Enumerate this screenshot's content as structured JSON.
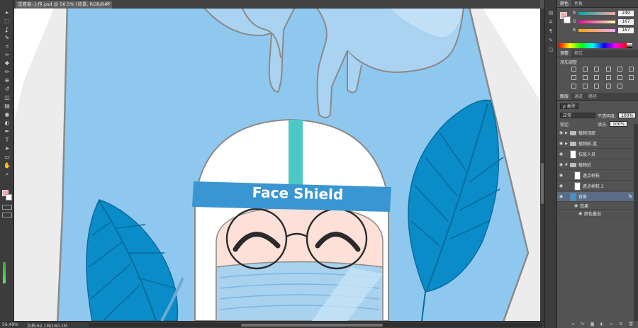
{
  "document": {
    "tab_title": "志愿者-上传.psd @ 56.5% (背景, RGB/8#)",
    "close_glyph": "×"
  },
  "canvas": {
    "banner_text": "Face Shield"
  },
  "status": {
    "zoom": "56.49%",
    "doc_size": "文档:62.1M/160.1M"
  },
  "colors": {
    "accent_blue": "#3a96d2",
    "teal_stripe": "#4cc8c4",
    "leaf_blue": "#0a8cc8",
    "face_pink": "#fde0d8",
    "mask_blue": "#a8d2ee",
    "foreground_swatch": "#f9a7a7"
  },
  "tools": [
    "move-tool",
    "marquee-tool",
    "lasso-tool",
    "quick-select-tool",
    "crop-tool",
    "eyedropper-tool",
    "spot-heal-tool",
    "brush-tool",
    "clone-stamp-tool",
    "history-brush-tool",
    "eraser-tool",
    "gradient-tool",
    "blur-tool",
    "dodge-tool",
    "pen-tool",
    "type-tool",
    "path-select-tool",
    "shape-tool",
    "hand-tool",
    "zoom-tool"
  ],
  "tool_glyphs": [
    "▸",
    "⬚",
    "ʆ",
    "✎",
    "⌗",
    "✑",
    "✚",
    "✏",
    "⊕",
    "↺",
    "◫",
    "▤",
    "◉",
    "◐",
    "✒",
    "T",
    "➤",
    "▭",
    "✋",
    "⌕"
  ],
  "color_panel": {
    "tabs": [
      "颜色",
      "色板"
    ],
    "channels": [
      {
        "ch": "R",
        "value": "249"
      },
      {
        "ch": "G",
        "value": "167"
      },
      {
        "ch": "B",
        "value": "167"
      }
    ]
  },
  "adjust_panel": {
    "tabs": [
      "调整",
      "样式"
    ],
    "title": "添加调整"
  },
  "layers_panel": {
    "tabs": [
      "图层",
      "通道",
      "路径"
    ],
    "filter_kind": "ρ 类型",
    "blend_mode": "正常",
    "opacity_label": "不透明度:",
    "opacity_value": "100%",
    "lock_label": "锁定:",
    "fill_label": "填充:",
    "fill_value": "100%",
    "layers": [
      {
        "name": "植物顶部",
        "type": "group",
        "indent": 0,
        "selected": false
      },
      {
        "name": "植物前-蓝",
        "type": "group",
        "indent": 0,
        "selected": false
      },
      {
        "name": "抗疫人员",
        "type": "layer",
        "indent": 0,
        "selected": false
      },
      {
        "name": "植物后",
        "type": "group-open",
        "indent": 0,
        "selected": false
      },
      {
        "name": "遮点树枝",
        "type": "layer",
        "indent": 1,
        "selected": false
      },
      {
        "name": "遮点树枝 2",
        "type": "layer",
        "indent": 1,
        "selected": false
      },
      {
        "name": "背景",
        "type": "layer",
        "indent": 0,
        "selected": true,
        "fx": "fx"
      },
      {
        "name": "效果",
        "type": "effect",
        "indent": 1,
        "selected": false
      },
      {
        "name": "颜色叠加",
        "type": "effect",
        "indent": 2,
        "selected": false
      }
    ],
    "footer_icons": [
      "∞",
      "fx",
      "◙",
      "◐",
      "▭",
      "⊞",
      "🗑"
    ]
  }
}
